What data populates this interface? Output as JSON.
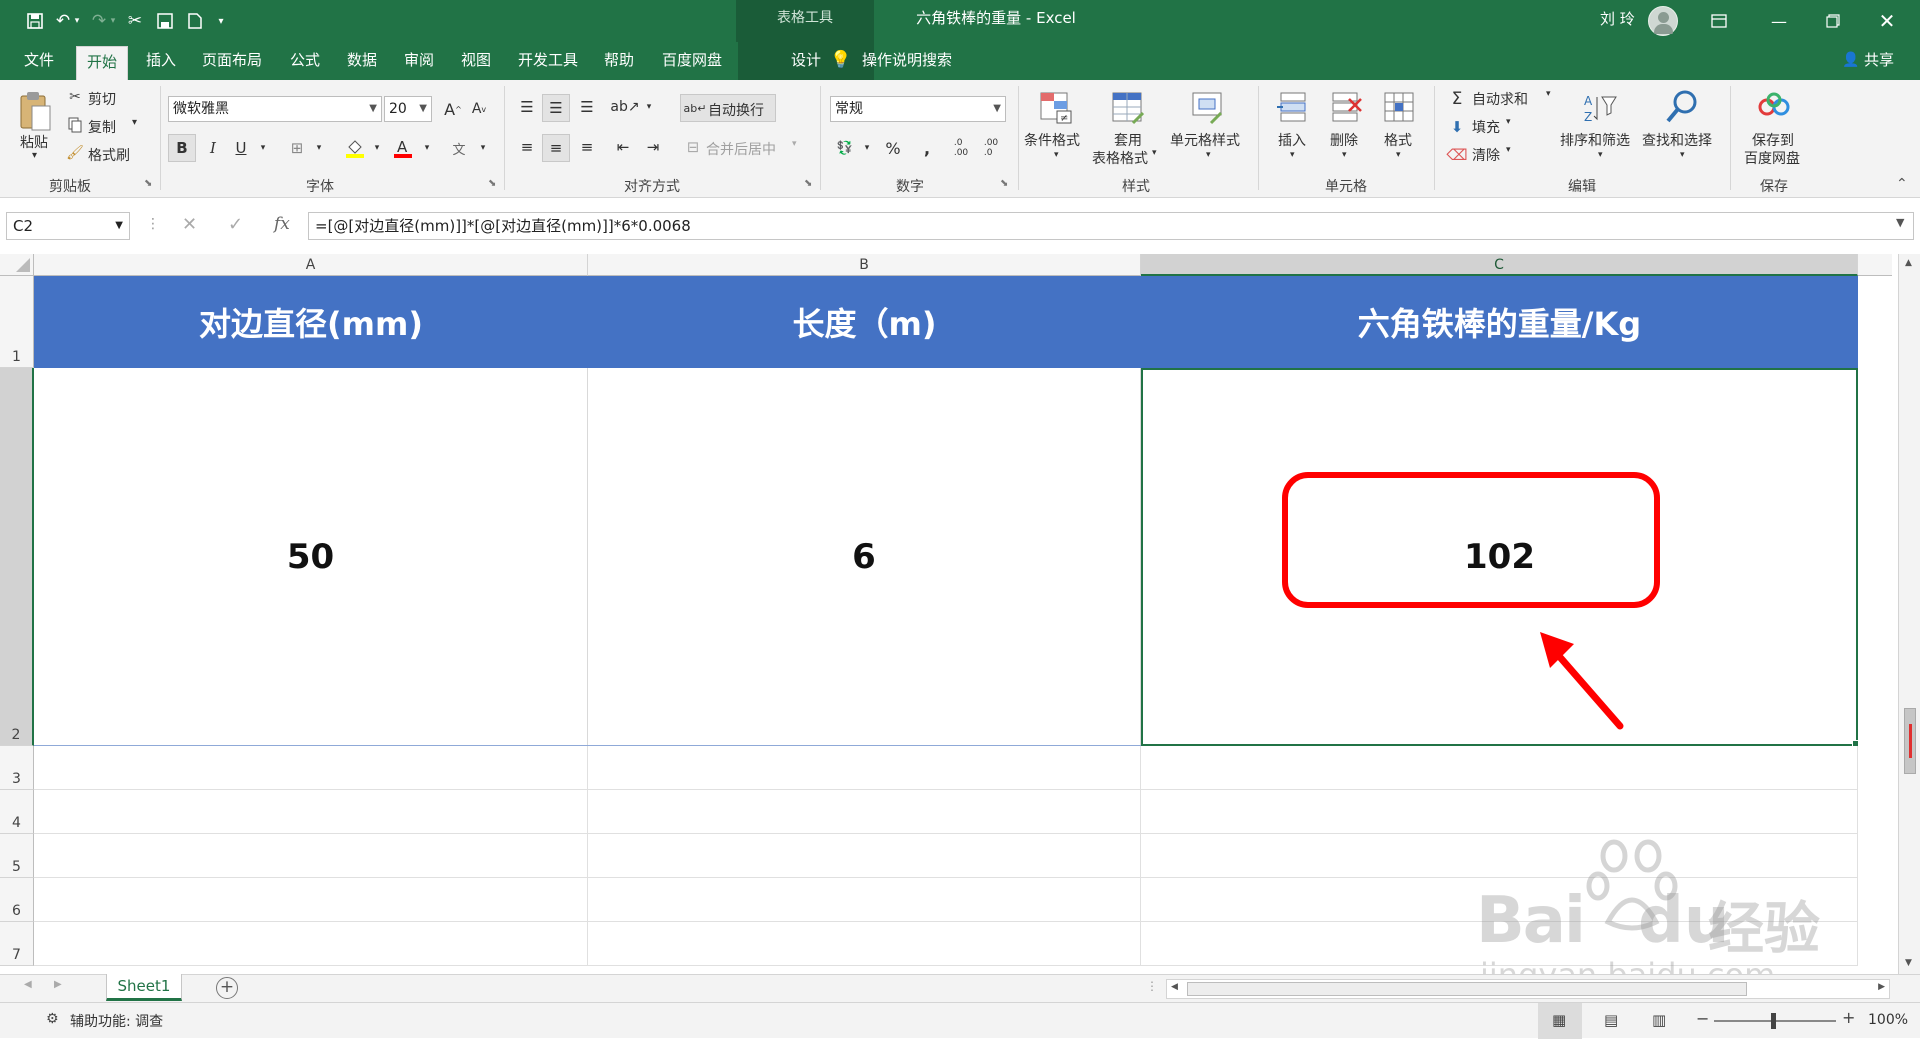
{
  "titlebar": {
    "context_tools": "表格工具",
    "doc_title": "六角铁棒的重量  -  Excel",
    "user_name": "刘 玲"
  },
  "tabs": [
    "文件",
    "开始",
    "插入",
    "页面布局",
    "公式",
    "数据",
    "审阅",
    "视图",
    "开发工具",
    "帮助",
    "百度网盘",
    "设计"
  ],
  "tell_me": "操作说明搜索",
  "share": "共享",
  "ribbon": {
    "clipboard": {
      "paste": "粘贴",
      "cut": "剪切",
      "copy": "复制",
      "format_painter": "格式刷",
      "label": "剪贴板"
    },
    "font": {
      "name": "微软雅黑",
      "size": "20",
      "label": "字体",
      "bold": "B",
      "italic": "I",
      "underline": "U"
    },
    "alignment": {
      "wrap_text": "自动换行",
      "merge_center": "合并后居中",
      "label": "对齐方式"
    },
    "number": {
      "format": "常规",
      "label": "数字"
    },
    "styles": {
      "conditional": "条件格式",
      "table_format_1": "套用",
      "table_format_2": "表格格式",
      "cell_styles": "单元格样式",
      "label": "样式"
    },
    "cells": {
      "insert": "插入",
      "delete": "删除",
      "format": "格式",
      "label": "单元格"
    },
    "editing": {
      "autosum": "自动求和",
      "fill": "填充",
      "clear": "清除",
      "sort_filter": "排序和筛选",
      "find_select": "查找和选择",
      "label": "编辑"
    },
    "save": {
      "line1": "保存到",
      "line2": "百度网盘",
      "label": "保存"
    }
  },
  "formula_bar": {
    "name_box": "C2",
    "formula": "=[@[对边直径(mm)]]*[@[对边直径(mm)]]*6*0.0068"
  },
  "columns": [
    "A",
    "B",
    "C"
  ],
  "rows": [
    "1",
    "2",
    "3",
    "4",
    "5",
    "6",
    "7"
  ],
  "table": {
    "headers": [
      "对边直径(mm)",
      "长度（m)",
      "六角铁棒的重量/Kg"
    ],
    "values": [
      "50",
      "6",
      "102"
    ]
  },
  "sheet_tab": "Sheet1",
  "status": {
    "accessibility": "辅助功能: 调查",
    "zoom": "100%"
  },
  "watermark": {
    "line1": "Bai",
    "line2": "du",
    "line3": "经验",
    "url": "jingyan.baidu.com"
  },
  "colors": {
    "excel_green": "#217346",
    "header_blue": "#4472c4",
    "highlight_red": "#ff0000"
  }
}
